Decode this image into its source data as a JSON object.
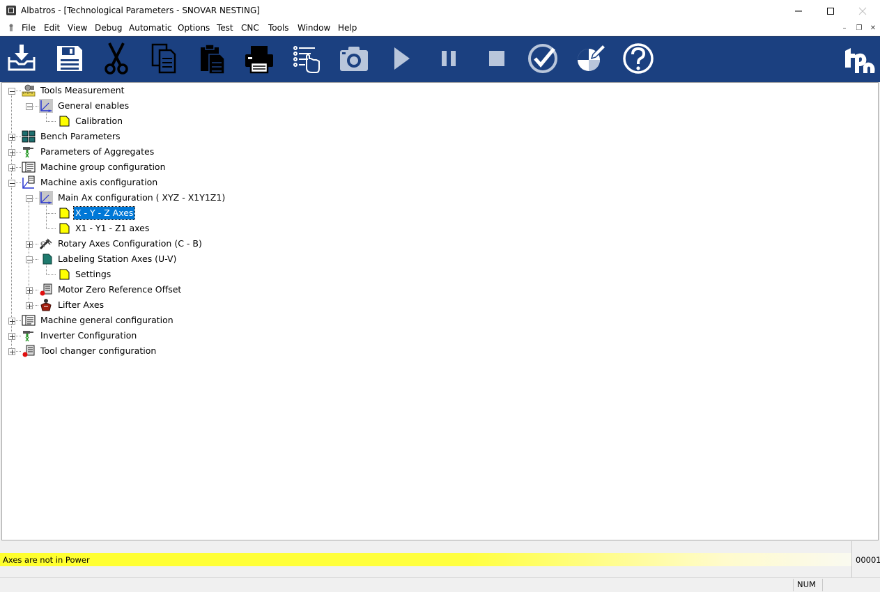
{
  "window": {
    "title": "Albatros - [Technological Parameters - SNOVAR NESTING]"
  },
  "menu": {
    "items": [
      "File",
      "Edit",
      "View",
      "Debug",
      "Automatic",
      "Options",
      "Test",
      "CNC",
      "Tools",
      "Window",
      "Help"
    ]
  },
  "toolbar": {
    "icons": [
      "download-icon",
      "save-icon",
      "cut-icon",
      "copy-icon",
      "paste-icon",
      "print-icon",
      "select-list-icon",
      "camera-icon",
      "play-icon",
      "pause-icon",
      "stop-icon",
      "check-icon",
      "chart-edit-icon",
      "help-icon"
    ],
    "brand": "tpa"
  },
  "tree": {
    "nodes": [
      {
        "label": "Tools Measurement"
      },
      {
        "label": "General enables"
      },
      {
        "label": "Calibration"
      },
      {
        "label": "Bench Parameters"
      },
      {
        "label": "Parameters of Aggregates"
      },
      {
        "label": "Machine group configuration"
      },
      {
        "label": "Machine axis configuration"
      },
      {
        "label": "Main Ax configuration ( XYZ - X1Y1Z1)"
      },
      {
        "label": "X - Y - Z Axes"
      },
      {
        "label": "X1 - Y1 - Z1 axes"
      },
      {
        "label": "Rotary Axes Configuration (C - B)"
      },
      {
        "label": "Labeling Station Axes (U-V)"
      },
      {
        "label": "Settings"
      },
      {
        "label": "Motor Zero Reference Offset"
      },
      {
        "label": "Lifter Axes"
      },
      {
        "label": "Machine general configuration"
      },
      {
        "label": "Inverter Configuration"
      },
      {
        "label": "Tool changer configuration"
      }
    ],
    "selected_label": "X - Y - Z Axes"
  },
  "status": {
    "message": "Axes are not in Power",
    "code": "00001",
    "num_indicator": "NUM"
  },
  "colors": {
    "toolbar_bg": "#1b4080",
    "selection": "#0078d7",
    "status_yellow": "#ffff2e"
  }
}
